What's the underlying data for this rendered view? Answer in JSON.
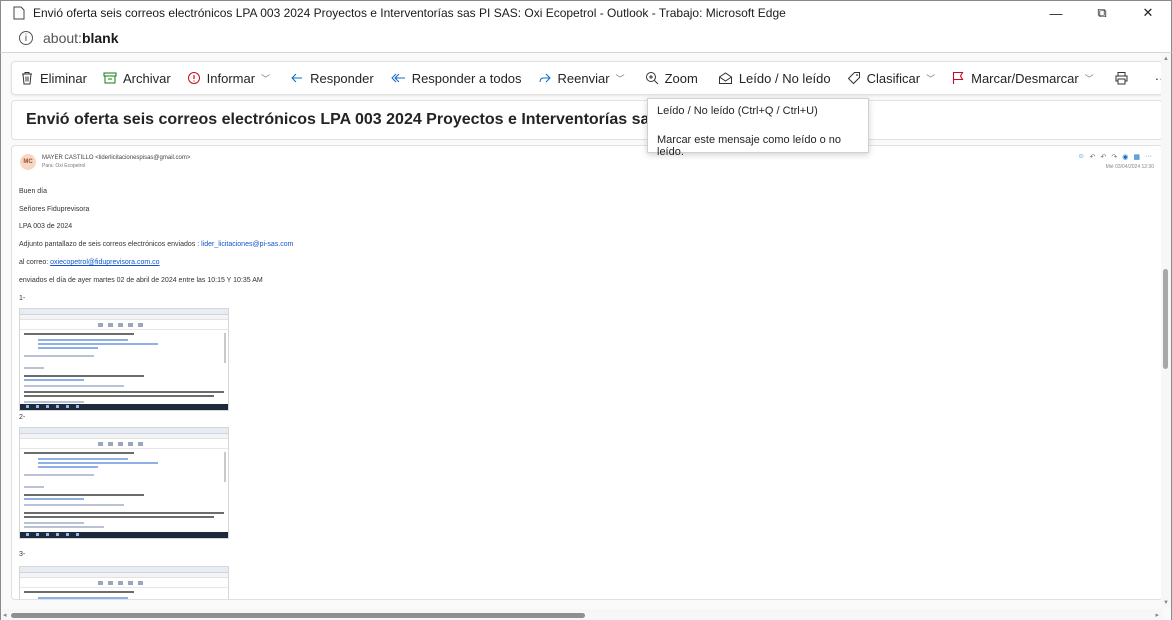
{
  "window": {
    "title": "Envió oferta seis correos electrónicos LPA 003 2024 Proyectos e Interventorías sas PI SAS: Oxi Ecopetrol - Outlook - Trabajo: Microsoft Edge",
    "minimize": "—",
    "restore": "⧉",
    "close": "✕"
  },
  "address": {
    "scheme": "about:",
    "page": "blank"
  },
  "toolbar": {
    "delete": "Eliminar",
    "archive": "Archivar",
    "report": "Informar",
    "reply": "Responder",
    "reply_all": "Responder a todos",
    "forward": "Reenviar",
    "zoom": "Zoom",
    "read_unread": "Leído / No leído",
    "categorize": "Clasificar",
    "flag": "Marcar/Desmarcar",
    "more": "···"
  },
  "tooltip": {
    "line1": "Leído / No leído (Ctrl+Q / Ctrl+U)",
    "line2": "Marcar este mensaje como leído o no leído."
  },
  "message": {
    "subject": "Envió oferta seis correos electrónicos LPA 003 2024 Proyectos e Interventorías sas PI SAS",
    "avatar_initials": "MC",
    "sender": "MAYER CASTILLO <liderlicitacionespisas@gmail.com>",
    "to": "Para:  Oxi Ecopetrol",
    "date": "Mié 03/04/2024 12:30",
    "body": {
      "greeting": "Buen día",
      "line1": "Señores Fiduprevisora",
      "line2": "LPA  003 de 2024",
      "line3_prefix": "Adjunto pantallazo de seis  correos electrónicos enviados : ",
      "line3_link": "lider_licitaciones@pi-sas.com",
      "line4_prefix": "al correo: ",
      "line4_link": "oxiecopetrol@fiduprevisora.com.co",
      "line5": "enviados el día  de ayer martes 02 de abril de 2024 entre las  10:15 Y 10:35 AM",
      "item1": "1-",
      "item2": "2-",
      "item3": "3-"
    }
  },
  "colors": {
    "link": "#1155cc",
    "flag": "#c50f1f",
    "report": "#c50f1f",
    "archive": "#0f7b0f",
    "accent": "#0f6cbd"
  }
}
